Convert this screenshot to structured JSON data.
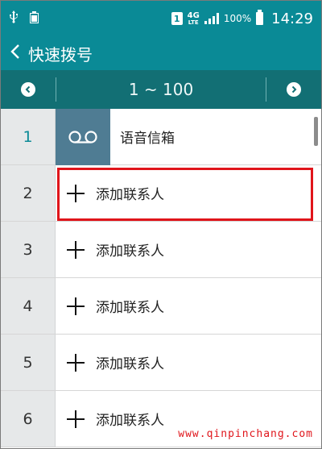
{
  "status_bar": {
    "sim_slot": "1",
    "network": "4G",
    "network_sub": "LTE",
    "battery_text": "100%",
    "time": "14:29"
  },
  "app_bar": {
    "title": "快速拨号"
  },
  "range": {
    "label": "1 ~ 100"
  },
  "entries": [
    {
      "number": "1",
      "label": "语音信箱",
      "kind": "voicemail",
      "icon": "voicemail-icon"
    },
    {
      "number": "2",
      "label": "添加联系人",
      "kind": "add",
      "icon": "plus-icon"
    },
    {
      "number": "3",
      "label": "添加联系人",
      "kind": "add",
      "icon": "plus-icon"
    },
    {
      "number": "4",
      "label": "添加联系人",
      "kind": "add",
      "icon": "plus-icon"
    },
    {
      "number": "5",
      "label": "添加联系人",
      "kind": "add",
      "icon": "plus-icon"
    },
    {
      "number": "6",
      "label": "添加联系人",
      "kind": "add",
      "icon": "plus-icon"
    }
  ],
  "watermark": "www.qinpinchang.com",
  "colors": {
    "header": "#0a8a96",
    "range_bar": "#126f74",
    "voicemail_tile": "#4f7c93",
    "highlight": "#e0151b"
  }
}
